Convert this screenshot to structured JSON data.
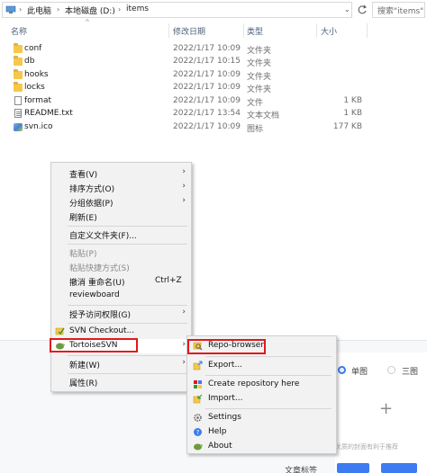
{
  "address_bar": {
    "crumbs": [
      "此电脑",
      "本地磁盘 (D:)",
      "items"
    ],
    "search_placeholder": "搜索\"items\""
  },
  "columns": {
    "name": "名称",
    "modified": "修改日期",
    "type": "类型",
    "size": "大小"
  },
  "files": [
    {
      "name": "conf",
      "modified": "2022/1/17 10:09",
      "type": "文件夹",
      "size": "",
      "icon": "folder-icon"
    },
    {
      "name": "db",
      "modified": "2022/1/17 10:15",
      "type": "文件夹",
      "size": "",
      "icon": "folder-icon"
    },
    {
      "name": "hooks",
      "modified": "2022/1/17 10:09",
      "type": "文件夹",
      "size": "",
      "icon": "folder-icon"
    },
    {
      "name": "locks",
      "modified": "2022/1/17 10:09",
      "type": "文件夹",
      "size": "",
      "icon": "folder-icon"
    },
    {
      "name": "format",
      "modified": "2022/1/17 10:09",
      "type": "文件",
      "size": "1 KB",
      "icon": "file-icon"
    },
    {
      "name": "README.txt",
      "modified": "2022/1/17 13:54",
      "type": "文本文档",
      "size": "1 KB",
      "icon": "text-file-icon"
    },
    {
      "name": "svn.ico",
      "modified": "2022/1/17 10:09",
      "type": "图标",
      "size": "177 KB",
      "icon": "svn-ico-icon"
    }
  ],
  "context_menu": {
    "view": "查看(V)",
    "sort_by": "排序方式(O)",
    "group_by": "分组依据(P)",
    "refresh": "刷新(E)",
    "customize_folder": "自定义文件夹(F)...",
    "paste": "粘贴(P)",
    "paste_shortcut": "粘贴快捷方式(S)",
    "undo_rename": "撤消 重命名(U)",
    "undo_shortcut": "Ctrl+Z",
    "reviewboard": "reviewboard",
    "grant_access": "授予访问权限(G)",
    "svn_checkout": "SVN Checkout...",
    "tortoisesvn": "TortoiseSVN",
    "new": "新建(W)",
    "properties": "属性(R)"
  },
  "tortoise_submenu": {
    "repo_browser": "Repo-browser",
    "export": "Export...",
    "create_repo": "Create repository here",
    "import": "Import...",
    "settings": "Settings",
    "help": "Help",
    "about": "About"
  },
  "background": {
    "single_image": "单图",
    "three_image": "三图",
    "cover_hint": "优质的封面有利于推荐",
    "article_tags": "文章标签"
  },
  "colors": {
    "highlight_box": "#e0191c",
    "accent_blue": "#3d7bf2",
    "menu_bg": "#f2f2f2"
  }
}
